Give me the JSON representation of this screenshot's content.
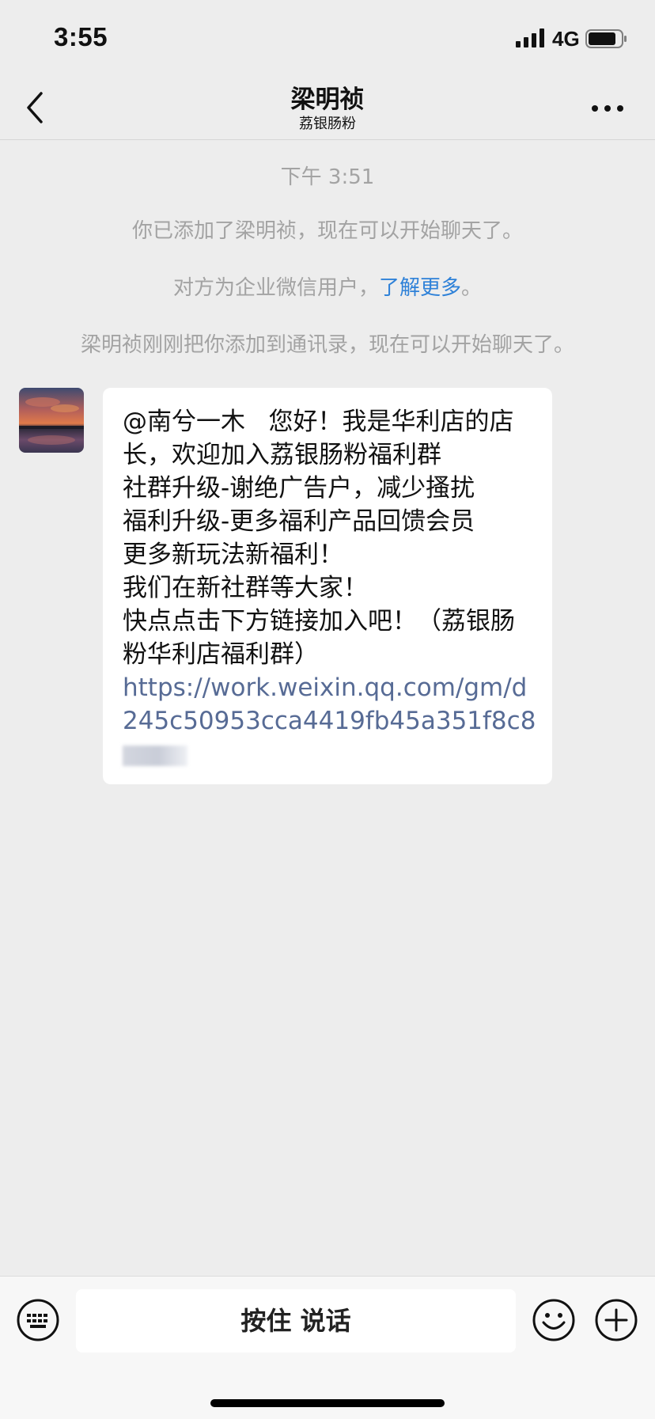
{
  "status_bar": {
    "time": "3:55",
    "network": "4G"
  },
  "nav": {
    "title": "梁明祯",
    "subtitle": "荔银肠粉"
  },
  "system_messages": {
    "timestamp": "下午 3:51",
    "added_notice": "你已添加了梁明祯，现在可以开始聊天了。",
    "enterprise_prefix": "对方为企业微信用户，",
    "enterprise_link": "了解更多",
    "enterprise_suffix": "。",
    "contact_notice": "梁明祯刚刚把你添加到通讯录，现在可以开始聊天了。"
  },
  "message": {
    "text": "@南兮一木   您好！我是华利店的店长，欢迎加入荔银肠粉福利群\n社群升级-谢绝广告户，减少搔扰\n福利升级-更多福利产品回馈会员\n更多新玩法新福利！\n我们在新社群等大家！\n快点点击下方链接加入吧！（荔银肠粉华利店福利群）",
    "link": "https://work.weixin.qq.com/gm/d245c50953cca4419fb45a351f8c8"
  },
  "input_bar": {
    "hold_to_talk_label": "按住 说话"
  },
  "colors": {
    "background": "#EDEDED",
    "link": "#576B95",
    "system_text": "#A3A3A3",
    "system_link": "#2E81D8"
  }
}
